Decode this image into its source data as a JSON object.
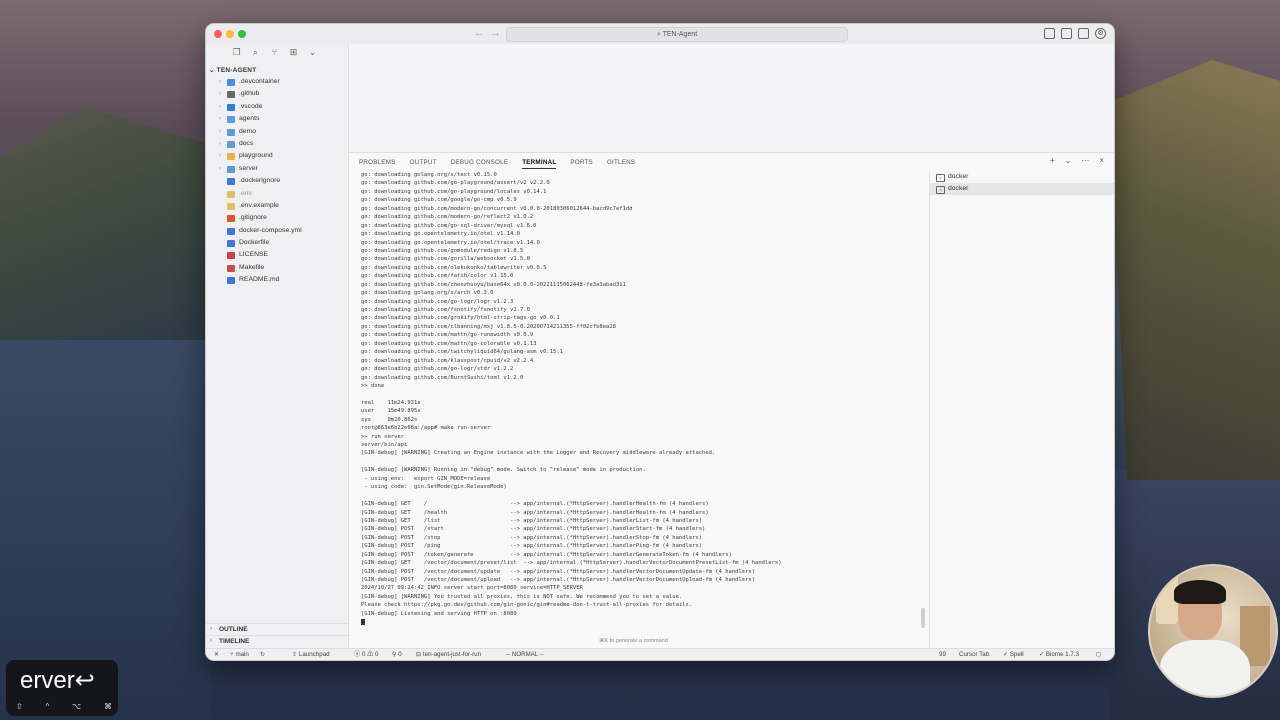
{
  "window": {
    "title": "TEN-Agent",
    "nav_back": "←",
    "nav_forward": "→"
  },
  "explorer": {
    "root": "TEN-AGENT",
    "items": [
      {
        "label": ".devcontainer",
        "type": "folder",
        "color": "#4a90e2",
        "chevron": "›"
      },
      {
        "label": ".github",
        "type": "folder",
        "color": "#6b6b6b",
        "chevron": "›"
      },
      {
        "label": ".vscode",
        "type": "folder",
        "color": "#2d7bd4",
        "chevron": "›"
      },
      {
        "label": "agents",
        "type": "folder",
        "color": "#5a9bd8",
        "chevron": "›"
      },
      {
        "label": "demo",
        "type": "folder",
        "color": "#5a9bd8",
        "chevron": "›"
      },
      {
        "label": "docs",
        "type": "folder",
        "color": "#5a9bd8",
        "chevron": "›"
      },
      {
        "label": "playground",
        "type": "folder",
        "color": "#e8b34a",
        "chevron": "›"
      },
      {
        "label": "server",
        "type": "folder",
        "color": "#5a9bd8",
        "chevron": "›"
      },
      {
        "label": ".dockerignore",
        "type": "file",
        "color": "#3c7ae0",
        "chevron": ""
      },
      {
        "label": ".env",
        "type": "file",
        "color": "#e0c060",
        "chevron": "",
        "muted": true
      },
      {
        "label": ".env.example",
        "type": "file",
        "color": "#e0c060",
        "chevron": ""
      },
      {
        "label": ".gitignore",
        "type": "file",
        "color": "#e0572c",
        "chevron": ""
      },
      {
        "label": "docker-compose.yml",
        "type": "file",
        "color": "#3c7ae0",
        "chevron": ""
      },
      {
        "label": "Dockerfile",
        "type": "file",
        "color": "#3c7ae0",
        "chevron": ""
      },
      {
        "label": "LICENSE",
        "type": "file",
        "color": "#d04040",
        "chevron": ""
      },
      {
        "label": "Makefile",
        "type": "file",
        "color": "#c05050",
        "chevron": ""
      },
      {
        "label": "README.md",
        "type": "file",
        "color": "#3c7ae0",
        "chevron": ""
      }
    ],
    "outline": "OUTLINE",
    "timeline": "TIMELINE"
  },
  "panel": {
    "tabs": [
      "PROBLEMS",
      "OUTPUT",
      "DEBUG CONSOLE",
      "TERMINAL",
      "PORTS",
      "GITLENS"
    ],
    "active_tab": "TERMINAL",
    "actions": [
      "+",
      "⌄",
      "···",
      "×"
    ],
    "terminals": [
      "docker",
      "docker"
    ],
    "hint": "⌘K to generate a command"
  },
  "terminal_lines": [
    "go: downloading golang.org/x/text v0.15.0",
    "go: downloading github.com/go-playground/assert/v2 v2.2.0",
    "go: downloading github.com/go-playground/locales v0.14.1",
    "go: downloading github.com/google/go-cmp v0.5.9",
    "go: downloading github.com/modern-go/concurrent v0.0.0-20180306012644-bacd9c7ef1dd",
    "go: downloading github.com/modern-go/reflect2 v1.0.2",
    "go: downloading github.com/go-sql-driver/mysql v1.6.0",
    "go: downloading go.opentelemetry.io/otel v1.14.0",
    "go: downloading go.opentelemetry.io/otel/trace v1.14.0",
    "go: downloading github.com/gomodule/redigo v1.8.5",
    "go: downloading github.com/gorilla/websocket v1.5.0",
    "go: downloading github.com/olekukonko/tablewriter v0.0.5",
    "go: downloading github.com/fatih/color v1.15.0",
    "go: downloading github.com/chenzhuoyu/base64x v0.0.0-20221115062448-fe3a3abad311",
    "go: downloading golang.org/x/arch v0.3.0",
    "go: downloading github.com/go-logr/logr v1.2.3",
    "go: downloading github.com/fsnotify/fsnotify v1.7.0",
    "go: downloading github.com/grokify/html-strip-tags-go v0.0.1",
    "go: downloading github.com/clbanning/mxj v1.8.5-0.20200714211355-ff02cfb8ea28",
    "go: downloading github.com/mattn/go-runewidth v0.0.9",
    "go: downloading github.com/mattn/go-colorable v0.1.13",
    "go: downloading github.com/twitchyliquid64/golang-asm v0.15.1",
    "go: downloading github.com/klauspost/cpuid/v2 v2.2.4",
    "go: downloading github.com/go-logr/stdr v1.2.2",
    "go: downloading github.com/BurntSushi/toml v1.2.0",
    ">> done",
    "",
    "real    11m24.931s",
    "user    15m49.895s",
    "sys     0m20.862s",
    "root@863e6b22e68a:/app# make run-server",
    ">> run server",
    "server/bin/api",
    "[GIN-debug] [WARNING] Creating an Engine instance with the Logger and Recovery middleware already attached.",
    "",
    "[GIN-debug] [WARNING] Running in \"debug\" mode. Switch to \"release\" mode in production.",
    " - using env:   export GIN_MODE=release",
    " - using code:  gin.SetMode(gin.ReleaseMode)",
    "",
    "[GIN-debug] GET    /                         --> app/internal.(*HttpServer).handlerHealth-fm (4 handlers)",
    "[GIN-debug] GET    /health                   --> app/internal.(*HttpServer).handlerHealth-fm (4 handlers)",
    "[GIN-debug] GET    /list                     --> app/internal.(*HttpServer).handlerList-fm (4 handlers)",
    "[GIN-debug] POST   /start                    --> app/internal.(*HttpServer).handlerStart-fm (4 handlers)",
    "[GIN-debug] POST   /stop                     --> app/internal.(*HttpServer).handlerStop-fm (4 handlers)",
    "[GIN-debug] POST   /ping                     --> app/internal.(*HttpServer).handlerPing-fm (4 handlers)",
    "[GIN-debug] POST   /token/generate           --> app/internal.(*HttpServer).handlerGenerateToken-fm (4 handlers)",
    "[GIN-debug] GET    /vector/document/preset/list  --> app/internal.(*HttpServer).handlerVectorDocumentPresetList-fm (4 handlers)",
    "[GIN-debug] POST   /vector/document/update   --> app/internal.(*HttpServer).handlerVectorDocumentUpdate-fm (4 handlers)",
    "[GIN-debug] POST   /vector/document/upload   --> app/internal.(*HttpServer).handlerVectorDocumentUpload-fm (4 handlers)",
    "2024/10/27 09:24:42 INFO server start port=8080 service=HTTP_SERVER",
    "[GIN-debug] [WARNING] You trusted all proxies, this is NOT safe. We recommend you to set a value.",
    "Please check https://pkg.go.dev/github.com/gin-gonic/gin#readme-don-t-trust-all-proxies for details.",
    "[GIN-debug] Listening and serving HTTP on :8080"
  ],
  "statusbar": {
    "remote": "✕",
    "branch": "main",
    "sync": "↻",
    "launchpad": "Launchpad",
    "errors": "0",
    "warnings": "0",
    "ports": "0",
    "task": "ten-agent-just-for-run",
    "mode": "-- NORMAL --",
    "count": "99",
    "cursor_tab": "Cursor Tab",
    "spell": "Spell",
    "biome": "Biome 1.7.3"
  },
  "keystroke_overlay": {
    "text": "erver↩",
    "keys": [
      "⇧",
      "^",
      "⌥",
      "⌘"
    ]
  },
  "colors": {
    "accent": "#2d7bd4",
    "terminal_text": "#3a3a3a"
  }
}
